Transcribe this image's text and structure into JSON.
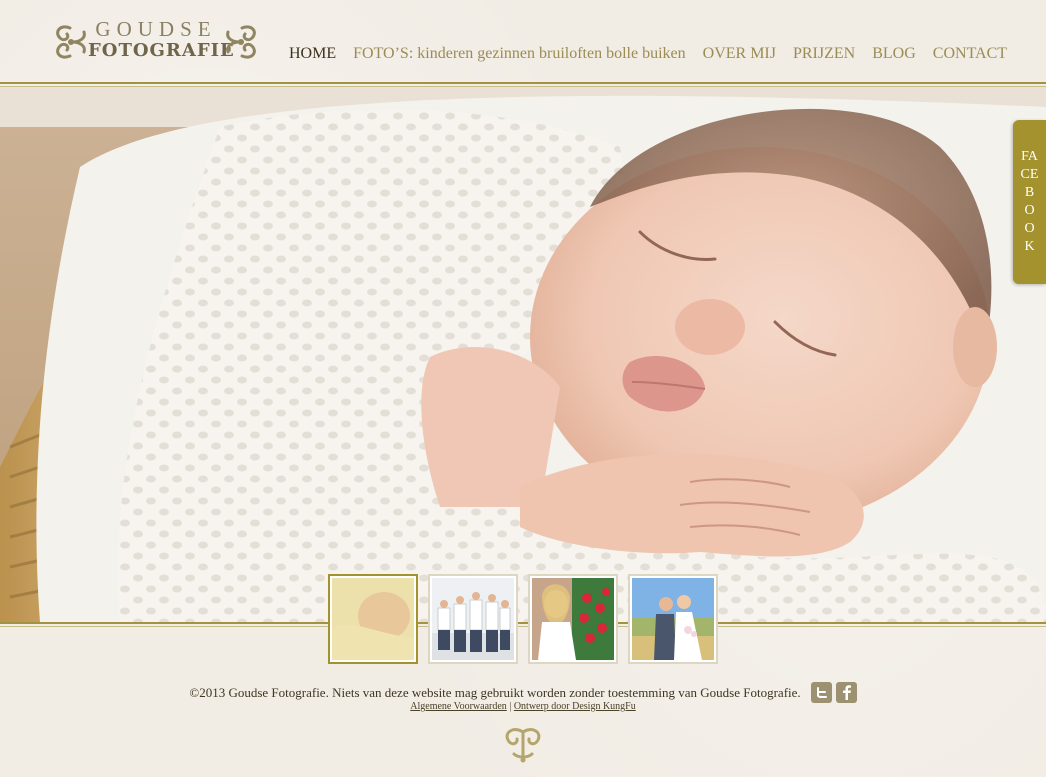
{
  "logo": {
    "line1": "GOUDSE",
    "line2": "FOTOGRAFIE",
    "ornament_icon": "scroll-ornament-icon"
  },
  "nav": {
    "items": [
      {
        "label": "HOME",
        "active": true
      },
      {
        "label": "FOTO’S: kinderen gezinnen bruiloften bolle buiken",
        "active": false
      },
      {
        "label": "OVER MIJ",
        "active": false
      },
      {
        "label": "PRIJZEN",
        "active": false
      },
      {
        "label": "BLOG",
        "active": false
      },
      {
        "label": "CONTACT",
        "active": false
      }
    ]
  },
  "facebook_tab": {
    "label": "FACEBOOK"
  },
  "thumbnails": [
    {
      "name": "thumb-newborn",
      "active": true
    },
    {
      "name": "thumb-family",
      "active": false
    },
    {
      "name": "thumb-bride",
      "active": false
    },
    {
      "name": "thumb-wedding-couple",
      "active": false
    }
  ],
  "footer": {
    "copyright": "©2013 Goudse Fotografie. Niets van deze website mag gebruikt worden zonder toestemming van Goudse Fotografie.",
    "twitter_icon": "twitter-icon",
    "facebook_icon": "facebook-icon",
    "link_terms": "Algemene Voorwaarden",
    "separator": "|",
    "link_design": "Ontwerp door Design KungFu"
  },
  "colors": {
    "accent": "#a3922e",
    "nav_text": "#9b8c55",
    "nav_active": "#3c331d",
    "background": "#f1ece4"
  }
}
